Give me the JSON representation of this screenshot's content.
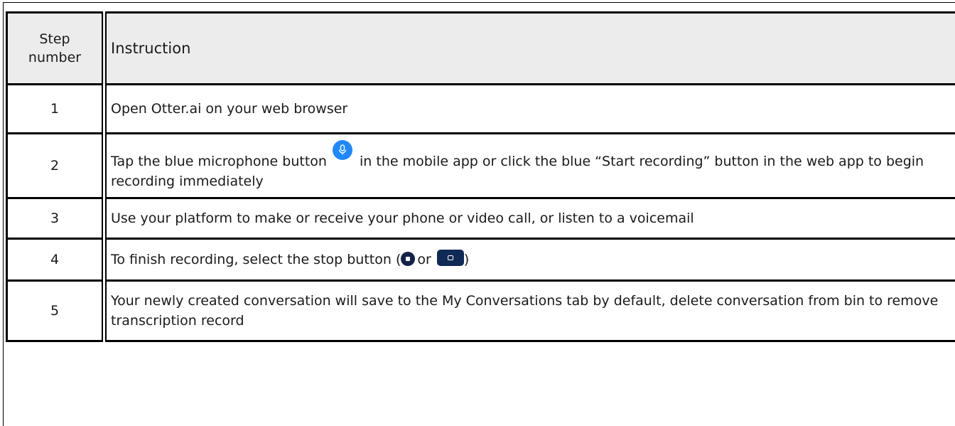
{
  "table": {
    "header": {
      "step_line1": "Step",
      "step_line2": "number",
      "instruction": "Instruction"
    },
    "rows": [
      {
        "number": "1",
        "instruction": "Open Otter.ai on your web browser"
      },
      {
        "number": "2",
        "instruction_before_icon": "Tap the blue microphone button",
        "instruction_after_icon": "in the mobile app or click the blue “Start recording” button in the web app to begin recording immediately",
        "icon": "microphone-icon",
        "icon_color": "#1e88ff"
      },
      {
        "number": "3",
        "instruction": "Use your platform to make or receive your phone or video call, or listen to a voicemail"
      },
      {
        "number": "4",
        "instruction_before_icons": "To finish recording, select the stop button (",
        "between_icons": "or",
        "instruction_after_icons": ")",
        "icons": [
          "stop-circle-icon",
          "stop-button-icon"
        ],
        "icon_color": "#14234a"
      },
      {
        "number": "5",
        "instruction": "Your newly created conversation will save to the My Conversations tab by default, delete conversation from bin to remove transcription record"
      }
    ]
  }
}
